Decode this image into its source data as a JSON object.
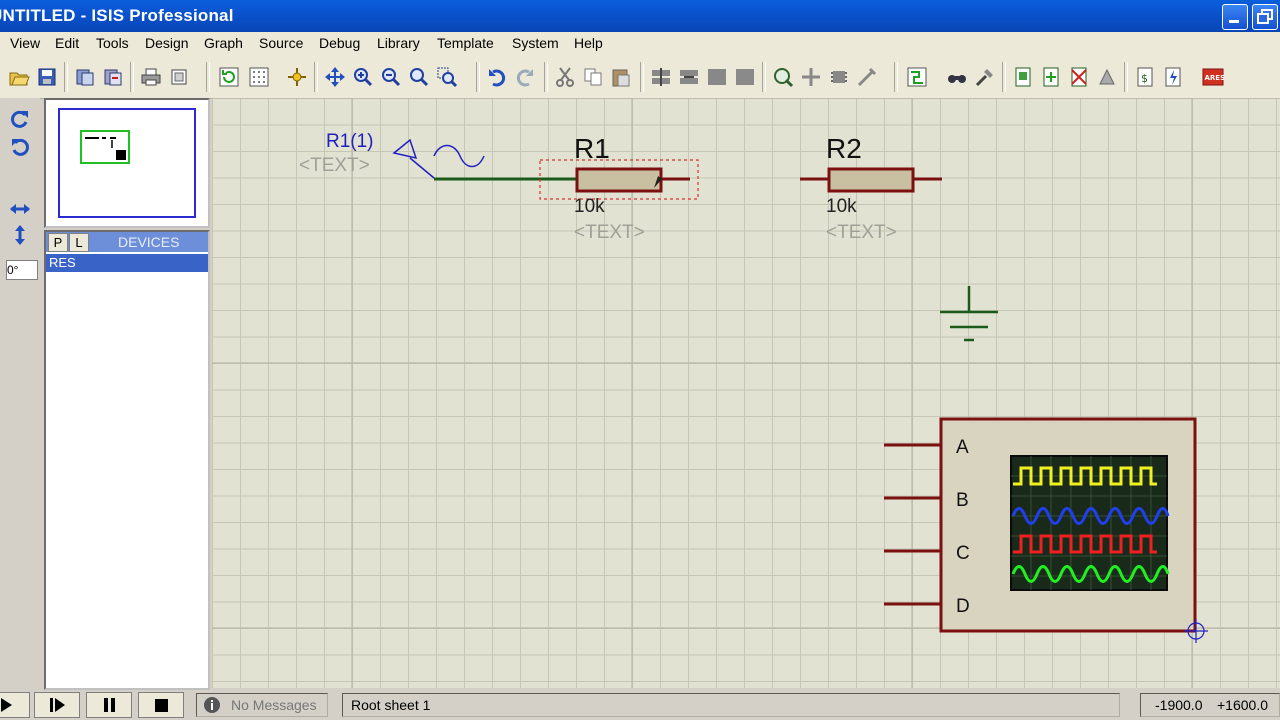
{
  "window": {
    "title": "UNTITLED - ISIS Professional"
  },
  "menu": [
    "View",
    "Edit",
    "Tools",
    "Design",
    "Graph",
    "Source",
    "Debug",
    "Library",
    "Template",
    "System",
    "Help"
  ],
  "rotation": {
    "angle": "0°"
  },
  "device_selector": {
    "tab_p": "P",
    "tab_l": "L",
    "title": "DEVICES",
    "items": [
      "RES"
    ]
  },
  "schematic": {
    "generator": {
      "label": "R1(1)",
      "text": "<TEXT>"
    },
    "r1": {
      "ref": "R1",
      "value": "10k",
      "text": "<TEXT>"
    },
    "r2": {
      "ref": "R2",
      "value": "10k",
      "text": "<TEXT>"
    },
    "scope": {
      "channels": [
        "A",
        "B",
        "C",
        "D"
      ]
    }
  },
  "status": {
    "messages": "No Messages",
    "sheet": "Root sheet 1",
    "coord_x": "-1900.0",
    "coord_y": "+1600.0"
  },
  "colors": {
    "title_bar": "#0a4ec6",
    "component_outline": "#7a1010",
    "component_fill": "#c8c0a0",
    "wire": "#1a5a1a",
    "selection": "#e03030",
    "label_blue": "#2020c0"
  }
}
